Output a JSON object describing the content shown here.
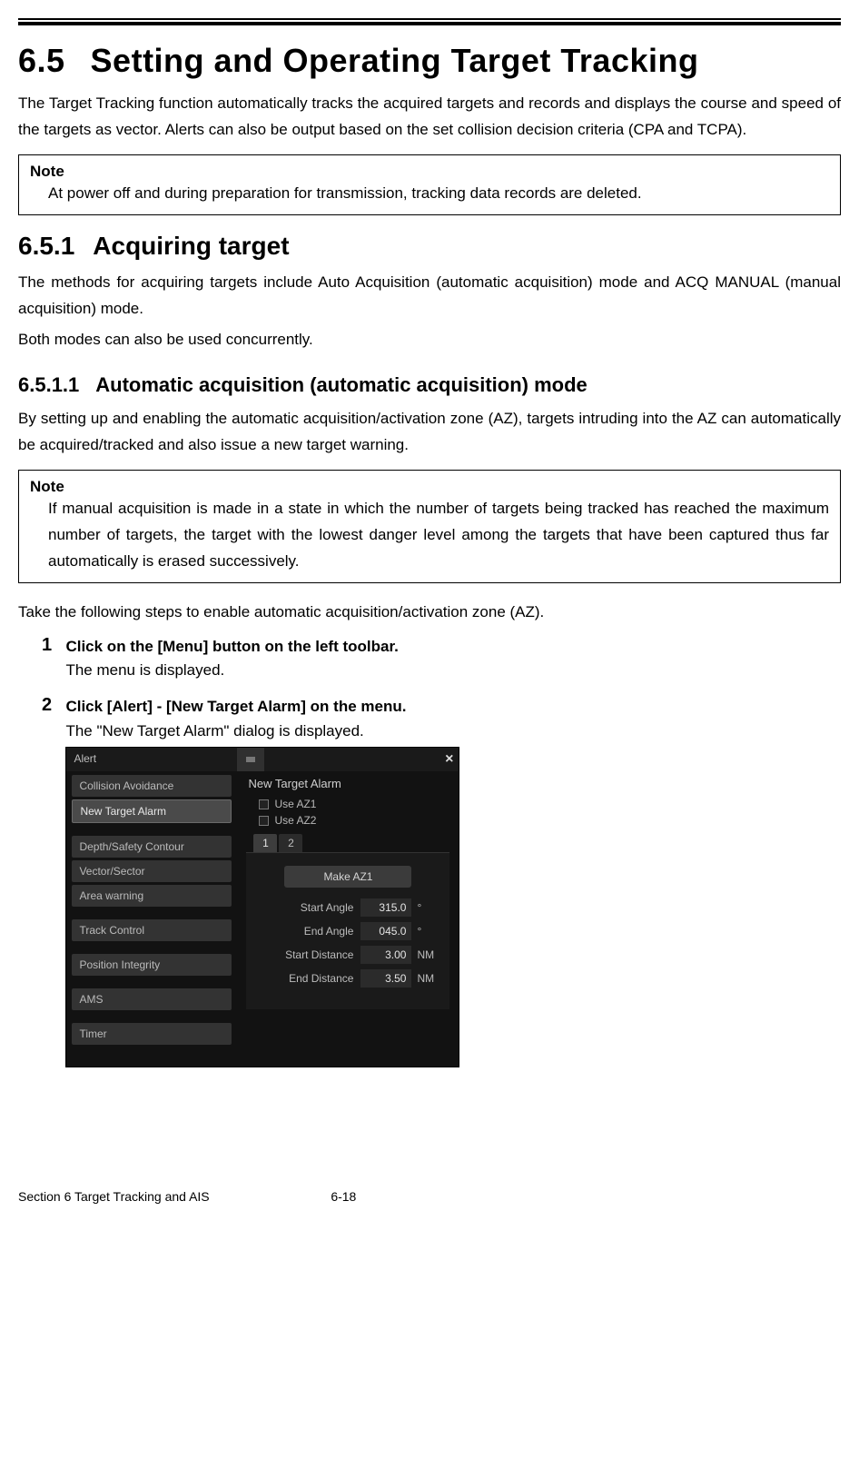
{
  "section_number": "6.5",
  "section_title": "Setting and Operating Target Tracking",
  "intro_para": "The Target Tracking function automatically tracks the acquired targets and records and displays the course and speed of the targets as vector. Alerts can also be output based on the set collision decision criteria (CPA and TCPA).",
  "note1": {
    "title": "Note",
    "body": "At power off and during preparation for transmission, tracking data records are deleted."
  },
  "sub_number": "6.5.1",
  "sub_title": "Acquiring target",
  "sub_para1": "The methods for acquiring targets include Auto Acquisition (automatic acquisition) mode and ACQ MANUAL (manual acquisition) mode.",
  "sub_para2": "Both modes can also be used concurrently.",
  "subsub_number": "6.5.1.1",
  "subsub_title": "Automatic acquisition (automatic acquisition) mode",
  "subsub_para": "By setting up and enabling the automatic acquisition/activation zone (AZ), targets intruding into the AZ can automatically be acquired/tracked and also issue a new target warning.",
  "note2": {
    "title": "Note",
    "body": "If manual acquisition is made in a state in which the number of targets being tracked has reached the maximum number of targets, the target with the lowest danger level among the targets that have been captured thus far automatically is erased successively."
  },
  "steps_intro": "Take the following steps to enable automatic acquisition/activation zone (AZ).",
  "step1": {
    "num": "1",
    "title": "Click on the [Menu] button on the left toolbar.",
    "desc": "The menu is displayed."
  },
  "step2": {
    "num": "2",
    "title": "Click [Alert] - [New Target Alarm] on the menu.",
    "desc": "The \"New Target Alarm\" dialog is displayed."
  },
  "dialog": {
    "title_left": "Alert",
    "panel_title": "New Target Alarm",
    "close": "×",
    "sidebar": {
      "group1": [
        "Collision Avoidance",
        "New Target Alarm"
      ],
      "group2": [
        "Depth/Safety Contour",
        "Vector/Sector",
        "Area warning"
      ],
      "group3": [
        "Track Control"
      ],
      "group4": [
        "Position Integrity"
      ],
      "group5": [
        "AMS"
      ],
      "group6": [
        "Timer"
      ]
    },
    "checkboxes": [
      "Use AZ1",
      "Use AZ2"
    ],
    "tabs": [
      "1",
      "2"
    ],
    "make_btn": "Make AZ1",
    "fields": [
      {
        "label": "Start Angle",
        "value": "315.0",
        "unit": "°"
      },
      {
        "label": "End Angle",
        "value": "045.0",
        "unit": "°"
      },
      {
        "label": "Start Distance",
        "value": "3.00",
        "unit": "NM"
      },
      {
        "label": "End Distance",
        "value": "3.50",
        "unit": "NM"
      }
    ]
  },
  "footer": {
    "left": "Section 6  Target Tracking and AIS",
    "right": "6-18"
  }
}
